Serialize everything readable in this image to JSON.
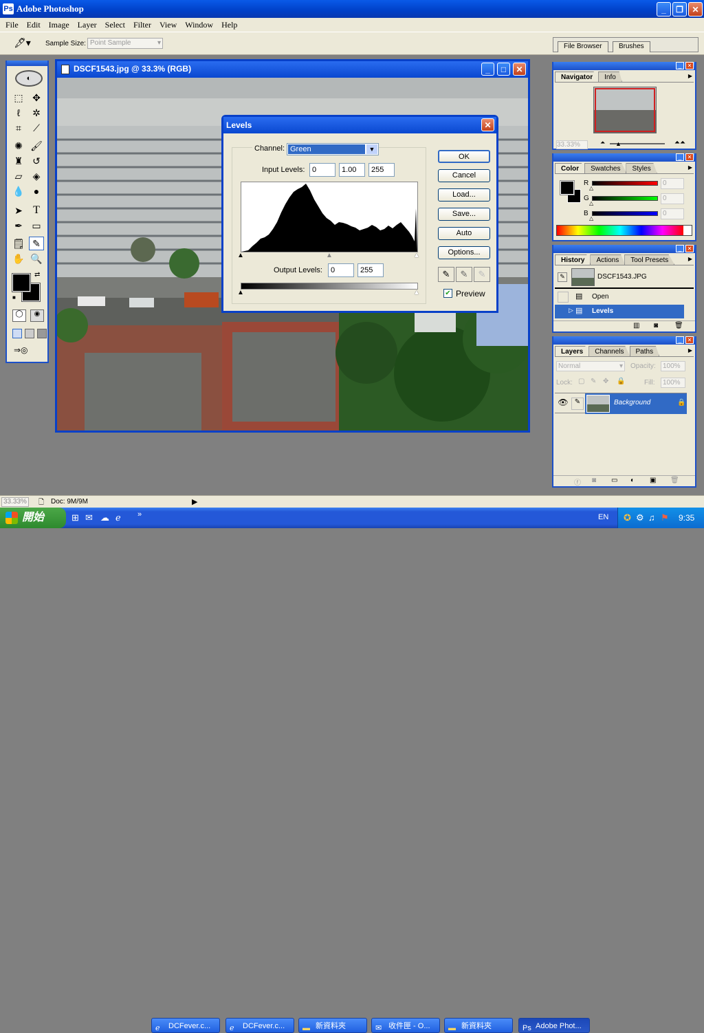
{
  "app": {
    "title": "Adobe Photoshop"
  },
  "menu": [
    "File",
    "Edit",
    "Image",
    "Layer",
    "Select",
    "Filter",
    "View",
    "Window",
    "Help"
  ],
  "options": {
    "sample_size_label": "Sample Size:",
    "sample_size_value": "Point Sample",
    "well_tabs": [
      "File Browser",
      "Brushes"
    ]
  },
  "document": {
    "title": "DSCF1543.jpg @ 33.3% (RGB)"
  },
  "levels": {
    "title": "Levels",
    "channel_label": "Channel:",
    "channel_value": "Green",
    "input_label": "Input Levels:",
    "input_black": "0",
    "input_gamma": "1.00",
    "input_white": "255",
    "output_label": "Output Levels:",
    "output_black": "0",
    "output_white": "255",
    "buttons": [
      "OK",
      "Cancel",
      "Load...",
      "Save...",
      "Auto",
      "Options..."
    ],
    "preview_label": "Preview",
    "preview_checked": true
  },
  "navigator": {
    "tabs": [
      "Navigator",
      "Info"
    ],
    "zoom": "33.33%"
  },
  "color": {
    "tabs": [
      "Color",
      "Swatches",
      "Styles"
    ],
    "channels": [
      {
        "name": "R",
        "value": "0"
      },
      {
        "name": "G",
        "value": "0"
      },
      {
        "name": "B",
        "value": "0"
      }
    ]
  },
  "history": {
    "tabs": [
      "History",
      "Actions",
      "Tool Presets"
    ],
    "snapshot": "DSCF1543.JPG",
    "items": [
      "Open",
      "Levels"
    ]
  },
  "layers": {
    "tabs": [
      "Layers",
      "Channels",
      "Paths"
    ],
    "blend": "Normal",
    "opacity_label": "Opacity:",
    "opacity": "100%",
    "lock_label": "Lock:",
    "fill_label": "Fill:",
    "fill": "100%",
    "layer_name": "Background"
  },
  "status": {
    "zoom": "33.33%",
    "doc": "Doc: 9M/9M"
  },
  "taskbar": {
    "start": "開始",
    "tasks": [
      "DCFever.c...",
      "DCFever.c...",
      "新資料夾",
      "收件匣 - O...",
      "新資料夾",
      "Adobe Phot..."
    ],
    "lang": "EN",
    "time": "9:35"
  }
}
